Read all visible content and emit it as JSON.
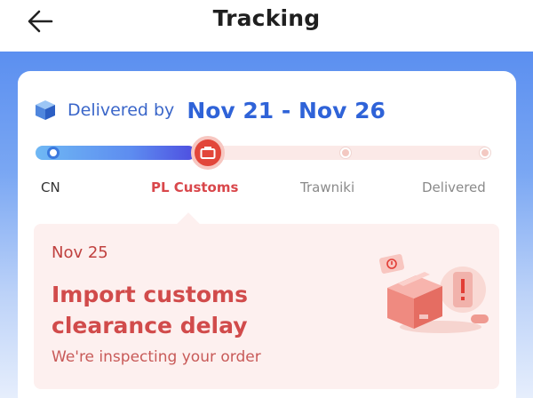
{
  "header": {
    "title": "Tracking",
    "back_icon": "arrow-left-icon"
  },
  "delivery": {
    "label": "Delivered by",
    "dates": "Nov 21 - Nov 26",
    "icon": "package-box-icon"
  },
  "progress": {
    "stops": [
      "CN",
      "PL Customs",
      "Trawniki",
      "Delivered"
    ],
    "current_index": 1,
    "current_icon": "customs-icon"
  },
  "event": {
    "date": "Nov 25",
    "title": "Import customs clearance delay",
    "subtitle": "We're inspecting your order",
    "illustration": "box-with-alert-illustration"
  },
  "colors": {
    "accent_blue": "#2f63d8",
    "alert_red": "#d14b4b",
    "panel_bg": "#fdf0ef"
  }
}
